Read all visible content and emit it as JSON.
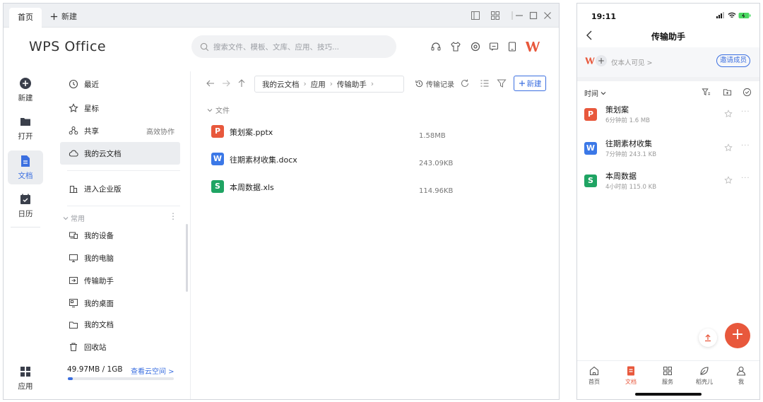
{
  "desktop": {
    "tabs": {
      "home": "首页",
      "new": "新建"
    },
    "app_logo": "WPS Office",
    "search_placeholder": "搜索文件、模板、文库、应用、技巧...",
    "rail": {
      "new": "新建",
      "open": "打开",
      "docs": "文档",
      "calendar": "日历",
      "apps": "应用"
    },
    "nav": {
      "recent": "最近",
      "starred": "星标",
      "shared": "共享",
      "shared_right": "高效协作",
      "my_cloud": "我的云文档",
      "enterprise": "进入企业版",
      "common": "常用",
      "my_device": "我的设备",
      "my_pc": "我的电脑",
      "transfer": "传输助手",
      "my_desktop": "我的桌面",
      "my_docs_partial": "我的文档",
      "recycle": "回收站"
    },
    "quota": {
      "text": "49.97MB / 1GB",
      "link": "查看云空间 >",
      "fraction": 0.049
    },
    "breadcrumb": [
      "我的云文档",
      "应用",
      "传输助手"
    ],
    "toolbar": {
      "history": "传输记录",
      "new": "新建"
    },
    "section": "文件",
    "files": [
      {
        "icon": "ppt-icon",
        "letter": "P",
        "color": "#e8583c",
        "name": "策划案.pptx",
        "size": "1.58MB"
      },
      {
        "icon": "word-icon",
        "letter": "W",
        "color": "#3b78e7",
        "name": "往期素材收集.docx",
        "size": "243.09KB"
      },
      {
        "icon": "excel-icon",
        "letter": "S",
        "color": "#1fa463",
        "name": "本周数据.xls",
        "size": "114.96KB"
      }
    ]
  },
  "phone": {
    "time": "19:11",
    "title": "传输助手",
    "visibility": "仅本人可见 >",
    "invite": "邀请成员",
    "sort": "时间",
    "files": [
      {
        "icon": "ppt-icon",
        "letter": "P",
        "color": "#e8583c",
        "name": "策划案",
        "meta": "6分钟前  1.6 MB"
      },
      {
        "icon": "word-icon",
        "letter": "W",
        "color": "#3b78e7",
        "name": "往期素材收集",
        "meta": "7分钟前  243.1 KB"
      },
      {
        "icon": "excel-icon",
        "letter": "S",
        "color": "#1fa463",
        "name": "本周数据",
        "meta": "4小时前  115.0 KB"
      }
    ],
    "tabs": [
      "首页",
      "文档",
      "服务",
      "稻壳儿",
      "我"
    ]
  },
  "colors": {
    "accent": "#3b6fe0",
    "wps_red": "#e8583c"
  }
}
